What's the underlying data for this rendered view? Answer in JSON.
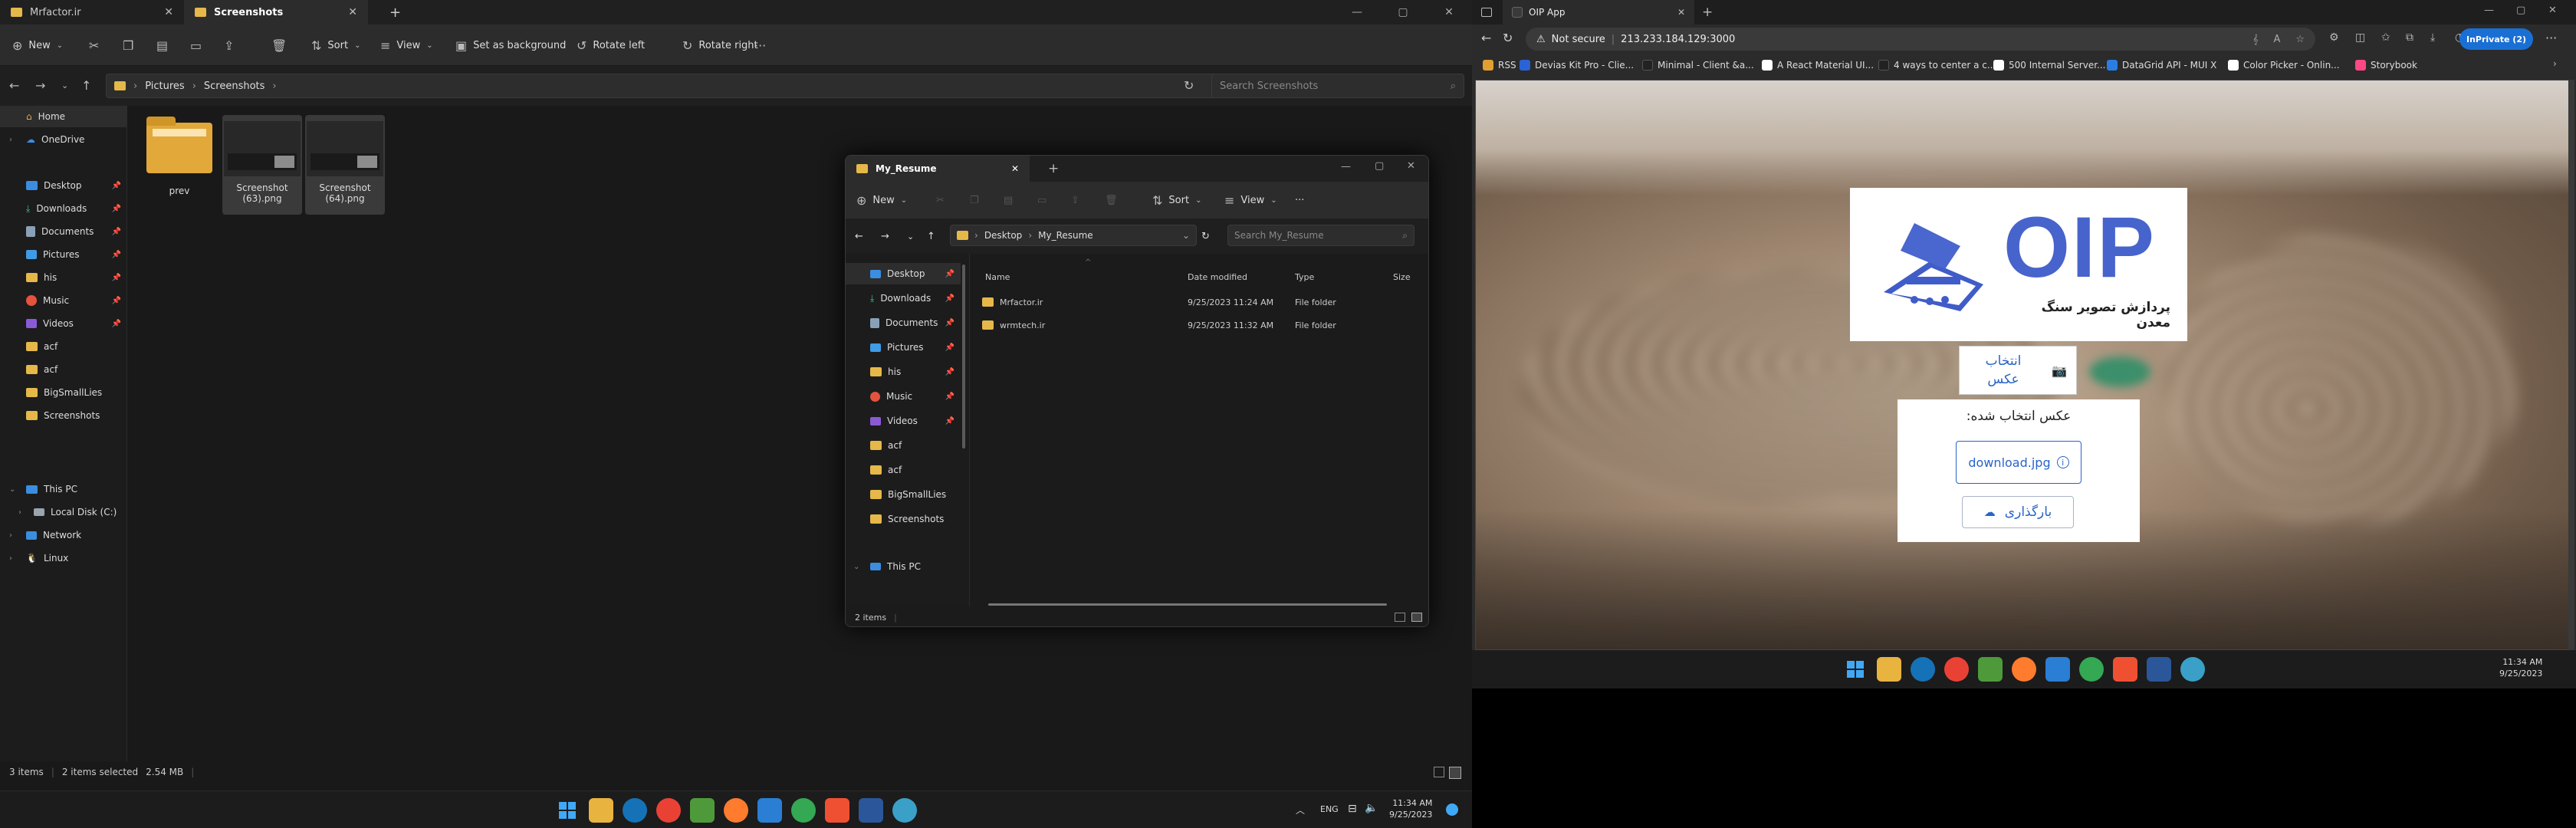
{
  "explorer": {
    "tabs": [
      {
        "label": "Mrfactor.ir"
      },
      {
        "label": "Screenshots"
      }
    ],
    "toolbar": {
      "new": "New",
      "sort": "Sort",
      "view": "View",
      "set_bg": "Set as background",
      "rotate_left": "Rotate left",
      "rotate_right": "Rotate right"
    },
    "breadcrumb": [
      "Pictures",
      "Screenshots"
    ],
    "search_placeholder": "Search Screenshots",
    "nav": {
      "home": "Home",
      "onedrive": "OneDrive",
      "quick": [
        "Desktop",
        "Downloads",
        "Documents",
        "Pictures",
        "his",
        "Music",
        "Videos",
        "acf",
        "acf",
        "BigSmallLies",
        "Screenshots"
      ],
      "this_pc": "This PC",
      "local_disk": "Local Disk (C:)",
      "network": "Network",
      "linux": "Linux"
    },
    "files": [
      {
        "name": "prev"
      },
      {
        "name": "Screenshot (63).png"
      },
      {
        "name": "Screenshot (64).png"
      }
    ],
    "status": {
      "items": "3 items",
      "selected": "2 items selected",
      "size": "2.54 MB"
    }
  },
  "window2": {
    "title": "My_Resume",
    "toolbar": {
      "new": "New",
      "sort": "Sort",
      "view": "View"
    },
    "breadcrumb": [
      "Desktop",
      "My_Resume"
    ],
    "search_placeholder": "Search My_Resume",
    "nav": [
      "Desktop",
      "Downloads",
      "Documents",
      "Pictures",
      "his",
      "Music",
      "Videos",
      "acf",
      "acf",
      "BigSmallLies",
      "Screenshots",
      "This PC"
    ],
    "columns": {
      "name": "Name",
      "date": "Date modified",
      "type": "Type",
      "size": "Size"
    },
    "rows": [
      {
        "name": "Mrfactor.ir",
        "date": "9/25/2023 11:24 AM",
        "type": "File folder"
      },
      {
        "name": "wrmtech.ir",
        "date": "9/25/2023 11:32 AM",
        "type": "File folder"
      }
    ],
    "status": "2 items"
  },
  "taskbar_left": {
    "lang": "ENG",
    "time": "11:34 AM",
    "date": "9/25/2023"
  },
  "edge": {
    "tab": "OIP App",
    "security": "Not secure",
    "url": "213.233.184.129:3000",
    "inprivate": "InPrivate (2)",
    "favorites": [
      "RSS",
      "Devias Kit Pro - Clie...",
      "Minimal - Client &a...",
      "A React Material UI...",
      "4 ways to center a c...",
      "500 Internal Server...",
      "DataGrid API - MUI X",
      "Color Picker - Onlin...",
      "Storybook"
    ],
    "favorite_colors": [
      "#e0a030",
      "#2a63d6",
      "#222222",
      "#ffffff",
      "#222222",
      "#ffffff",
      "#2a7de1",
      "#ffffff",
      "#ff4785"
    ]
  },
  "app": {
    "logo_text": "OIP",
    "logo_subtitle": "پردازش تصویر سنگ معدن",
    "select_button": "انتخاب عکس",
    "selected_label": "عکس انتخاب شده:",
    "file_chip": "download.jpg",
    "upload_button": "بارگذاری"
  },
  "taskbar_right": {
    "time": "11:34 AM",
    "date": "9/25/2023"
  }
}
